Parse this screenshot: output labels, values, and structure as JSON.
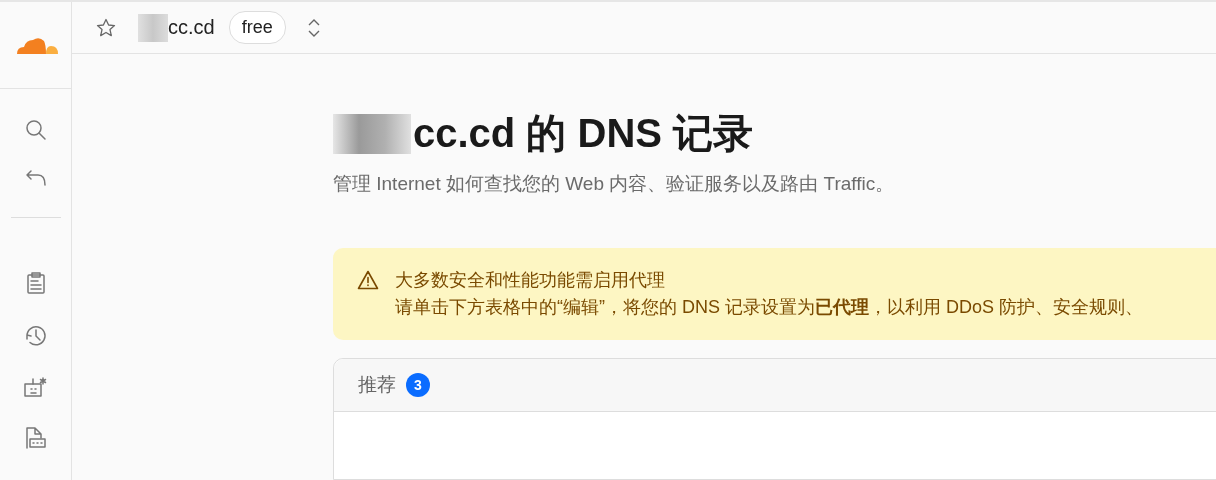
{
  "header": {
    "domain": "cc.cd",
    "plan": "free"
  },
  "page": {
    "title": "cc.cd 的 DNS 记录",
    "subtitle": "管理 Internet 如何查找您的 Web 内容、验证服务以及路由 Traffic。"
  },
  "banner": {
    "title": "大多数安全和性能功能需启用代理",
    "message": "请单击下方表格中的“编辑”，将您的 DNS 记录设置为**已代理**，以利用 DDoS 防护、安全规则、"
  },
  "card": {
    "title": "推荐",
    "count": "3"
  }
}
